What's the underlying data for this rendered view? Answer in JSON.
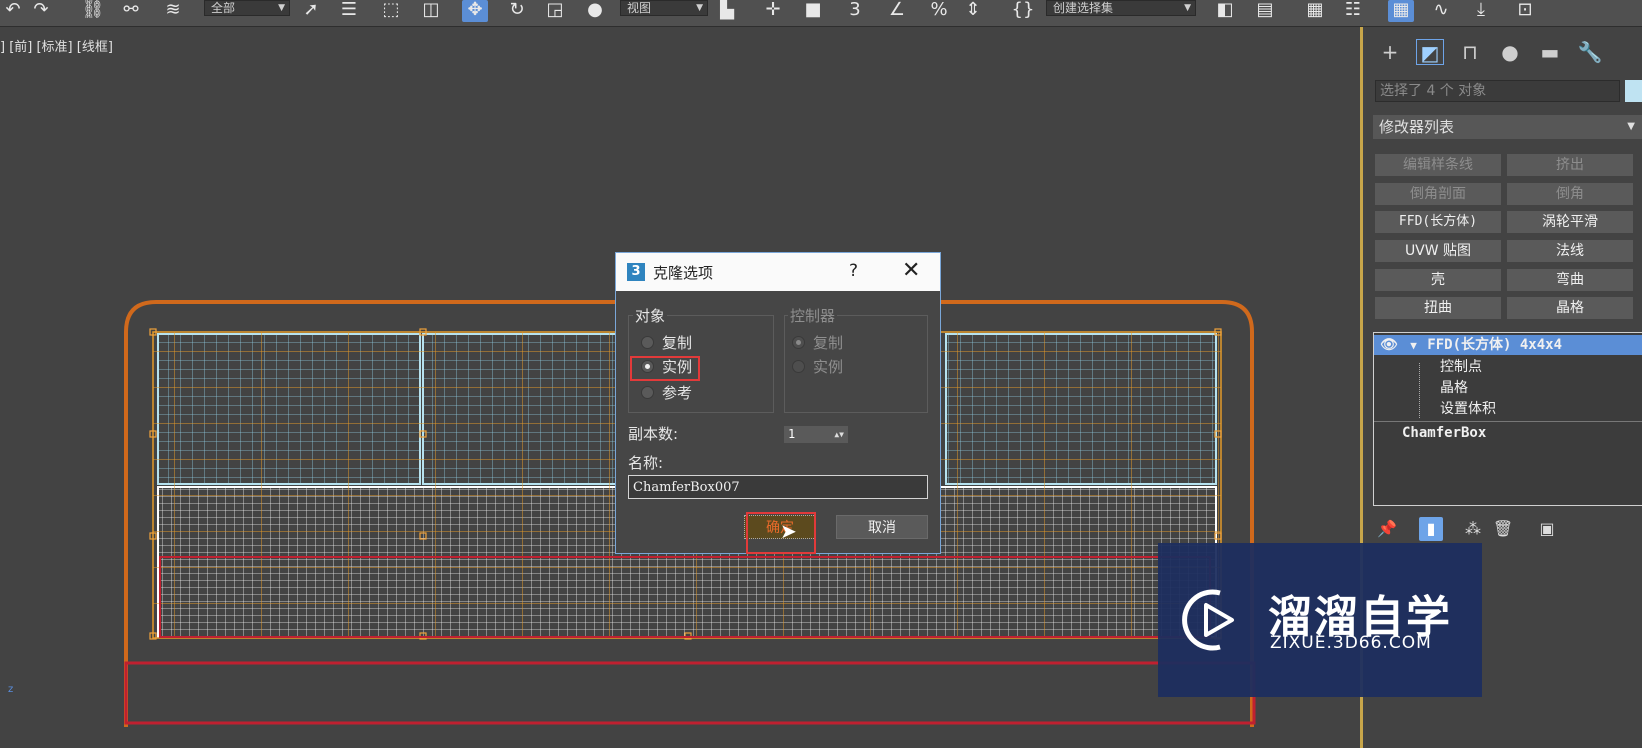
{
  "toolbar": {
    "selection_filter": "全部",
    "ref_coord": "视图",
    "named_selection": "创建选择集"
  },
  "viewport": {
    "label": "] [前] [标准] [线框]",
    "axis_label": "z"
  },
  "command_panel": {
    "selection_info": "选择了 4 个 对象",
    "modifier_list": "修改器列表",
    "modifier_buttons": [
      {
        "label": "编辑样条线",
        "enabled": false
      },
      {
        "label": "挤出",
        "enabled": false
      },
      {
        "label": "倒角剖面",
        "enabled": false
      },
      {
        "label": "倒角",
        "enabled": false
      },
      {
        "label": "FFD(长方体)",
        "enabled": true
      },
      {
        "label": "涡轮平滑",
        "enabled": true
      },
      {
        "label": "UVW 贴图",
        "enabled": true
      },
      {
        "label": "法线",
        "enabled": true
      },
      {
        "label": "壳",
        "enabled": true
      },
      {
        "label": "弯曲",
        "enabled": true
      },
      {
        "label": "扭曲",
        "enabled": true
      },
      {
        "label": "晶格",
        "enabled": true
      }
    ],
    "stack": {
      "selected": "FFD(长方体) 4x4x4",
      "sub_items": [
        "控制点",
        "晶格",
        "设置体积"
      ],
      "base": "ChamferBox"
    },
    "swatch_color": "#bfe3f2"
  },
  "dialog": {
    "title": "克隆选项",
    "help": "?",
    "close": "✕",
    "object_group": {
      "label": "对象",
      "options": [
        "复制",
        "实例",
        "参考"
      ],
      "selected": "实例"
    },
    "controller_group": {
      "label": "控制器",
      "options": [
        "复制",
        "实例"
      ],
      "selected": "复制"
    },
    "copies_label": "副本数:",
    "copies_value": "1",
    "name_label": "名称:",
    "name_value": "ChamferBox007",
    "ok_label": "确定",
    "cancel_label": "取消"
  },
  "watermark": {
    "text": "溜溜自学",
    "url": "ZIXUE.3D66.COM"
  }
}
